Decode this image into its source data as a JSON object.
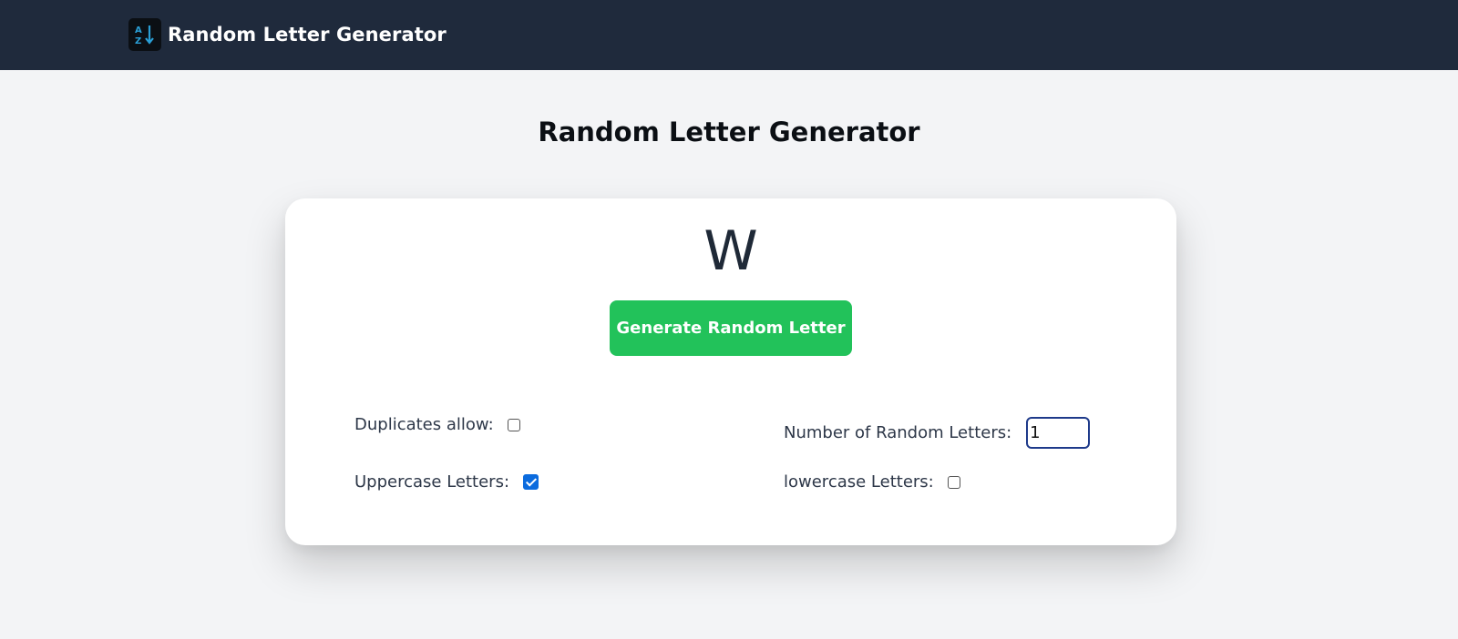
{
  "header": {
    "logo_icon": "sort-alpha-down-icon",
    "logo_colors": {
      "background": "#0b0f14",
      "letters": "#2a9fd6",
      "arrow": "#2a9fd6"
    },
    "title": "Random Letter Generator",
    "background": "#1f2a3c"
  },
  "main": {
    "title": "Random Letter Generator",
    "current_letter": "W",
    "generate_button_label": "Generate Random Letter",
    "generate_button_color": "#22c25a"
  },
  "options": {
    "duplicates": {
      "label": "Duplicates allow:",
      "checked": false
    },
    "uppercase": {
      "label": "Uppercase Letters:",
      "checked": true
    },
    "count": {
      "label": "Number of Random Letters:",
      "value": "1"
    },
    "lowercase": {
      "label": "lowercase Letters:",
      "checked": false
    }
  },
  "colors": {
    "page_background": "#f3f4f6",
    "card_background": "#ffffff",
    "checkbox_checked": "#0b6bde",
    "input_border": "#1e3a8a"
  }
}
